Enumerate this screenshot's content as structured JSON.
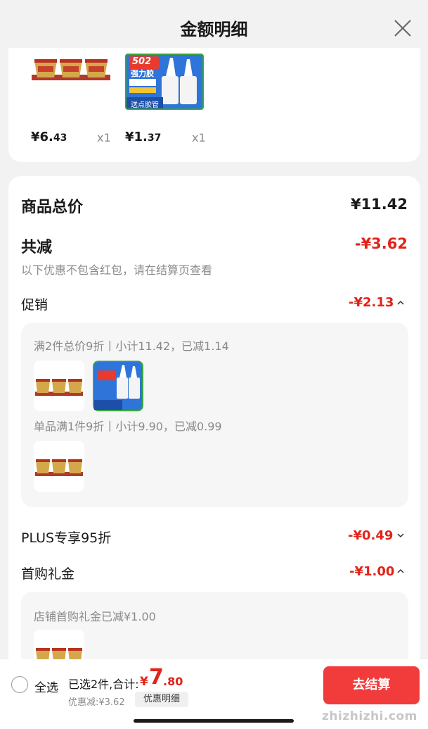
{
  "header": {
    "title": "金额明细",
    "close_icon": "close-icon"
  },
  "top_items": [
    {
      "price_int": "¥6.",
      "price_dec": "43",
      "qty": "x1"
    },
    {
      "price_int": "¥1.",
      "price_dec": "37",
      "qty": "x1"
    }
  ],
  "glue_product": {
    "line1": "502",
    "line2": "强力胶",
    "tag": "送点胶管"
  },
  "summary": {
    "total_label": "商品总价",
    "total_value": "¥11.42",
    "reduce_label": "共减",
    "reduce_value": "-¥3.62",
    "reduce_note": "以下优惠不包含红包，请在结算页查看"
  },
  "promotion": {
    "label": "促销",
    "value": "-¥2.13",
    "rule1": "满2件总价9折丨小计11.42，已减1.14",
    "rule2": "单品满1件9折丨小计9.90，已减0.99"
  },
  "plus": {
    "label": "PLUS专享95折",
    "value": "-¥0.49"
  },
  "first_purchase": {
    "label": "首购礼金",
    "value": "-¥1.00",
    "rule": "店铺首购礼金已减¥1.00"
  },
  "bottom": {
    "select_all": "全选",
    "selected_text": "已选2件,合计:",
    "total_symbol": "¥",
    "total_int": "7",
    "total_dec": ".80",
    "saved_text": "优惠减:¥3.62",
    "detail_button": "优惠明细",
    "checkout_label": "去结算",
    "watermark": "zhizhizhi.com"
  },
  "colors": {
    "accent_red": "#e2231a",
    "checkout_red": "#f23b3b"
  }
}
